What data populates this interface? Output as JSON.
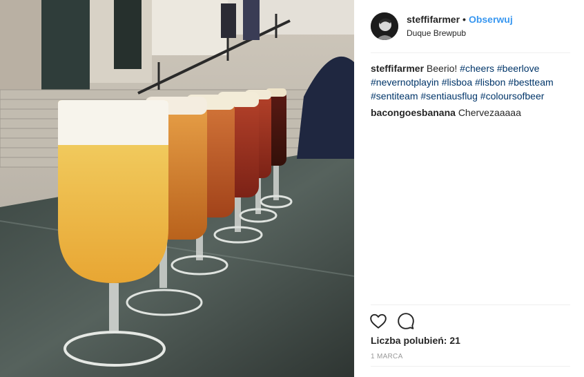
{
  "post": {
    "photo_alt": "",
    "author": {
      "username": "steffifarmer",
      "separator": "•",
      "follow_label": "Obserwuj",
      "location": "Duque Brewpub"
    },
    "caption": {
      "username": "steffifarmer",
      "text": "Beerio!",
      "hashtags": [
        "#cheers",
        "#beerlove",
        "#nevernotplayin",
        "#lisboa",
        "#lisbon",
        "#bestteam",
        "#sentiteam",
        "#sentiausflug",
        "#coloursofbeer"
      ]
    },
    "comments": [
      {
        "username": "bacongoesbanana",
        "text": "Chervezaaaaa"
      }
    ],
    "actions": {
      "like_icon": "heart-icon",
      "comment_icon": "comment-bubble-icon"
    },
    "likes_label": "Liczba polubień: 21",
    "date": "1 MARCA"
  },
  "colors": {
    "follow": "#3897f0",
    "hashtag": "#003569",
    "divider": "#efefef",
    "date": "#999999"
  }
}
